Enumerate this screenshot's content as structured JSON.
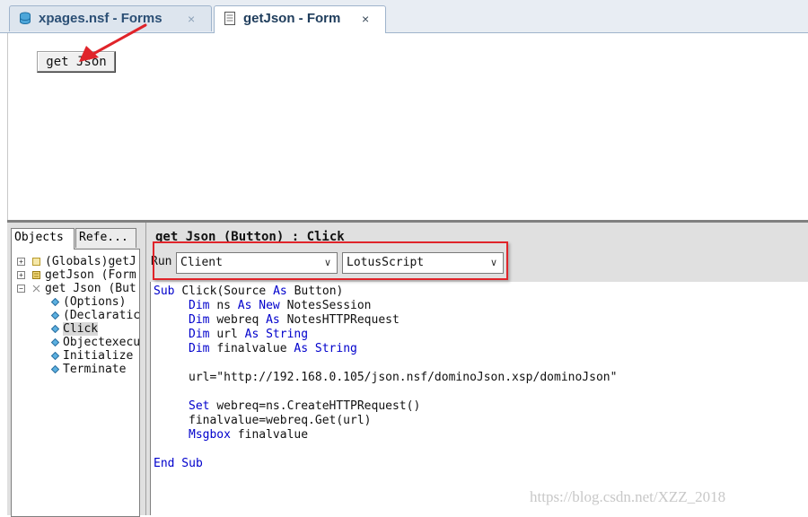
{
  "tabs": [
    {
      "label": "xpages.nsf - Forms",
      "close": "×",
      "icon": "database-icon",
      "active": false
    },
    {
      "label": "getJson - Form",
      "close": "×",
      "icon": "form-icon",
      "active": true
    }
  ],
  "canvas": {
    "button_label": "get Json"
  },
  "left_panel": {
    "tabs": [
      "Objects",
      "Refe..."
    ],
    "tree": [
      {
        "label": "(Globals)getJ"
      },
      {
        "label": "getJson (Form"
      },
      {
        "label": "get Json (But"
      },
      {
        "label": "(Options)"
      },
      {
        "label": "(Declaratic"
      },
      {
        "label": "Click"
      },
      {
        "label": "Objectexecu"
      },
      {
        "label": "Initialize"
      },
      {
        "label": "Terminate"
      }
    ]
  },
  "code_panel": {
    "title": "get Json (Button) : Click",
    "run_label": "Run",
    "run_target": "Client",
    "language": "LotusScript"
  },
  "code": {
    "line1": [
      "Sub ",
      "Click(",
      "Source ",
      "As ",
      "Button)"
    ],
    "line2": [
      "Dim ",
      "ns ",
      "As ",
      "New ",
      "NotesSession"
    ],
    "line3": [
      "Dim ",
      "webreq ",
      "As ",
      "NotesHTTPRequest"
    ],
    "line4": [
      "Dim ",
      "url ",
      "As ",
      "String"
    ],
    "line5": [
      "Dim ",
      "finalvalue ",
      "As ",
      "String"
    ],
    "line6": "url=\"http://192.168.0.105/json.nsf/dominoJson.xsp/dominoJson\"",
    "line7": [
      "Set ",
      "webreq=ns.CreateHTTPRequest()"
    ],
    "line8": "finalvalue=webreq.Get(url)",
    "line9": [
      "Msgbox ",
      "finalvalue"
    ],
    "line10": "End Sub"
  },
  "colors": {
    "keyword": "#0000cc",
    "annotation_red": "#e0242a",
    "tab_border": "#9fb4cc"
  },
  "watermark": "https://blog.csdn.net/XZZ_2018"
}
